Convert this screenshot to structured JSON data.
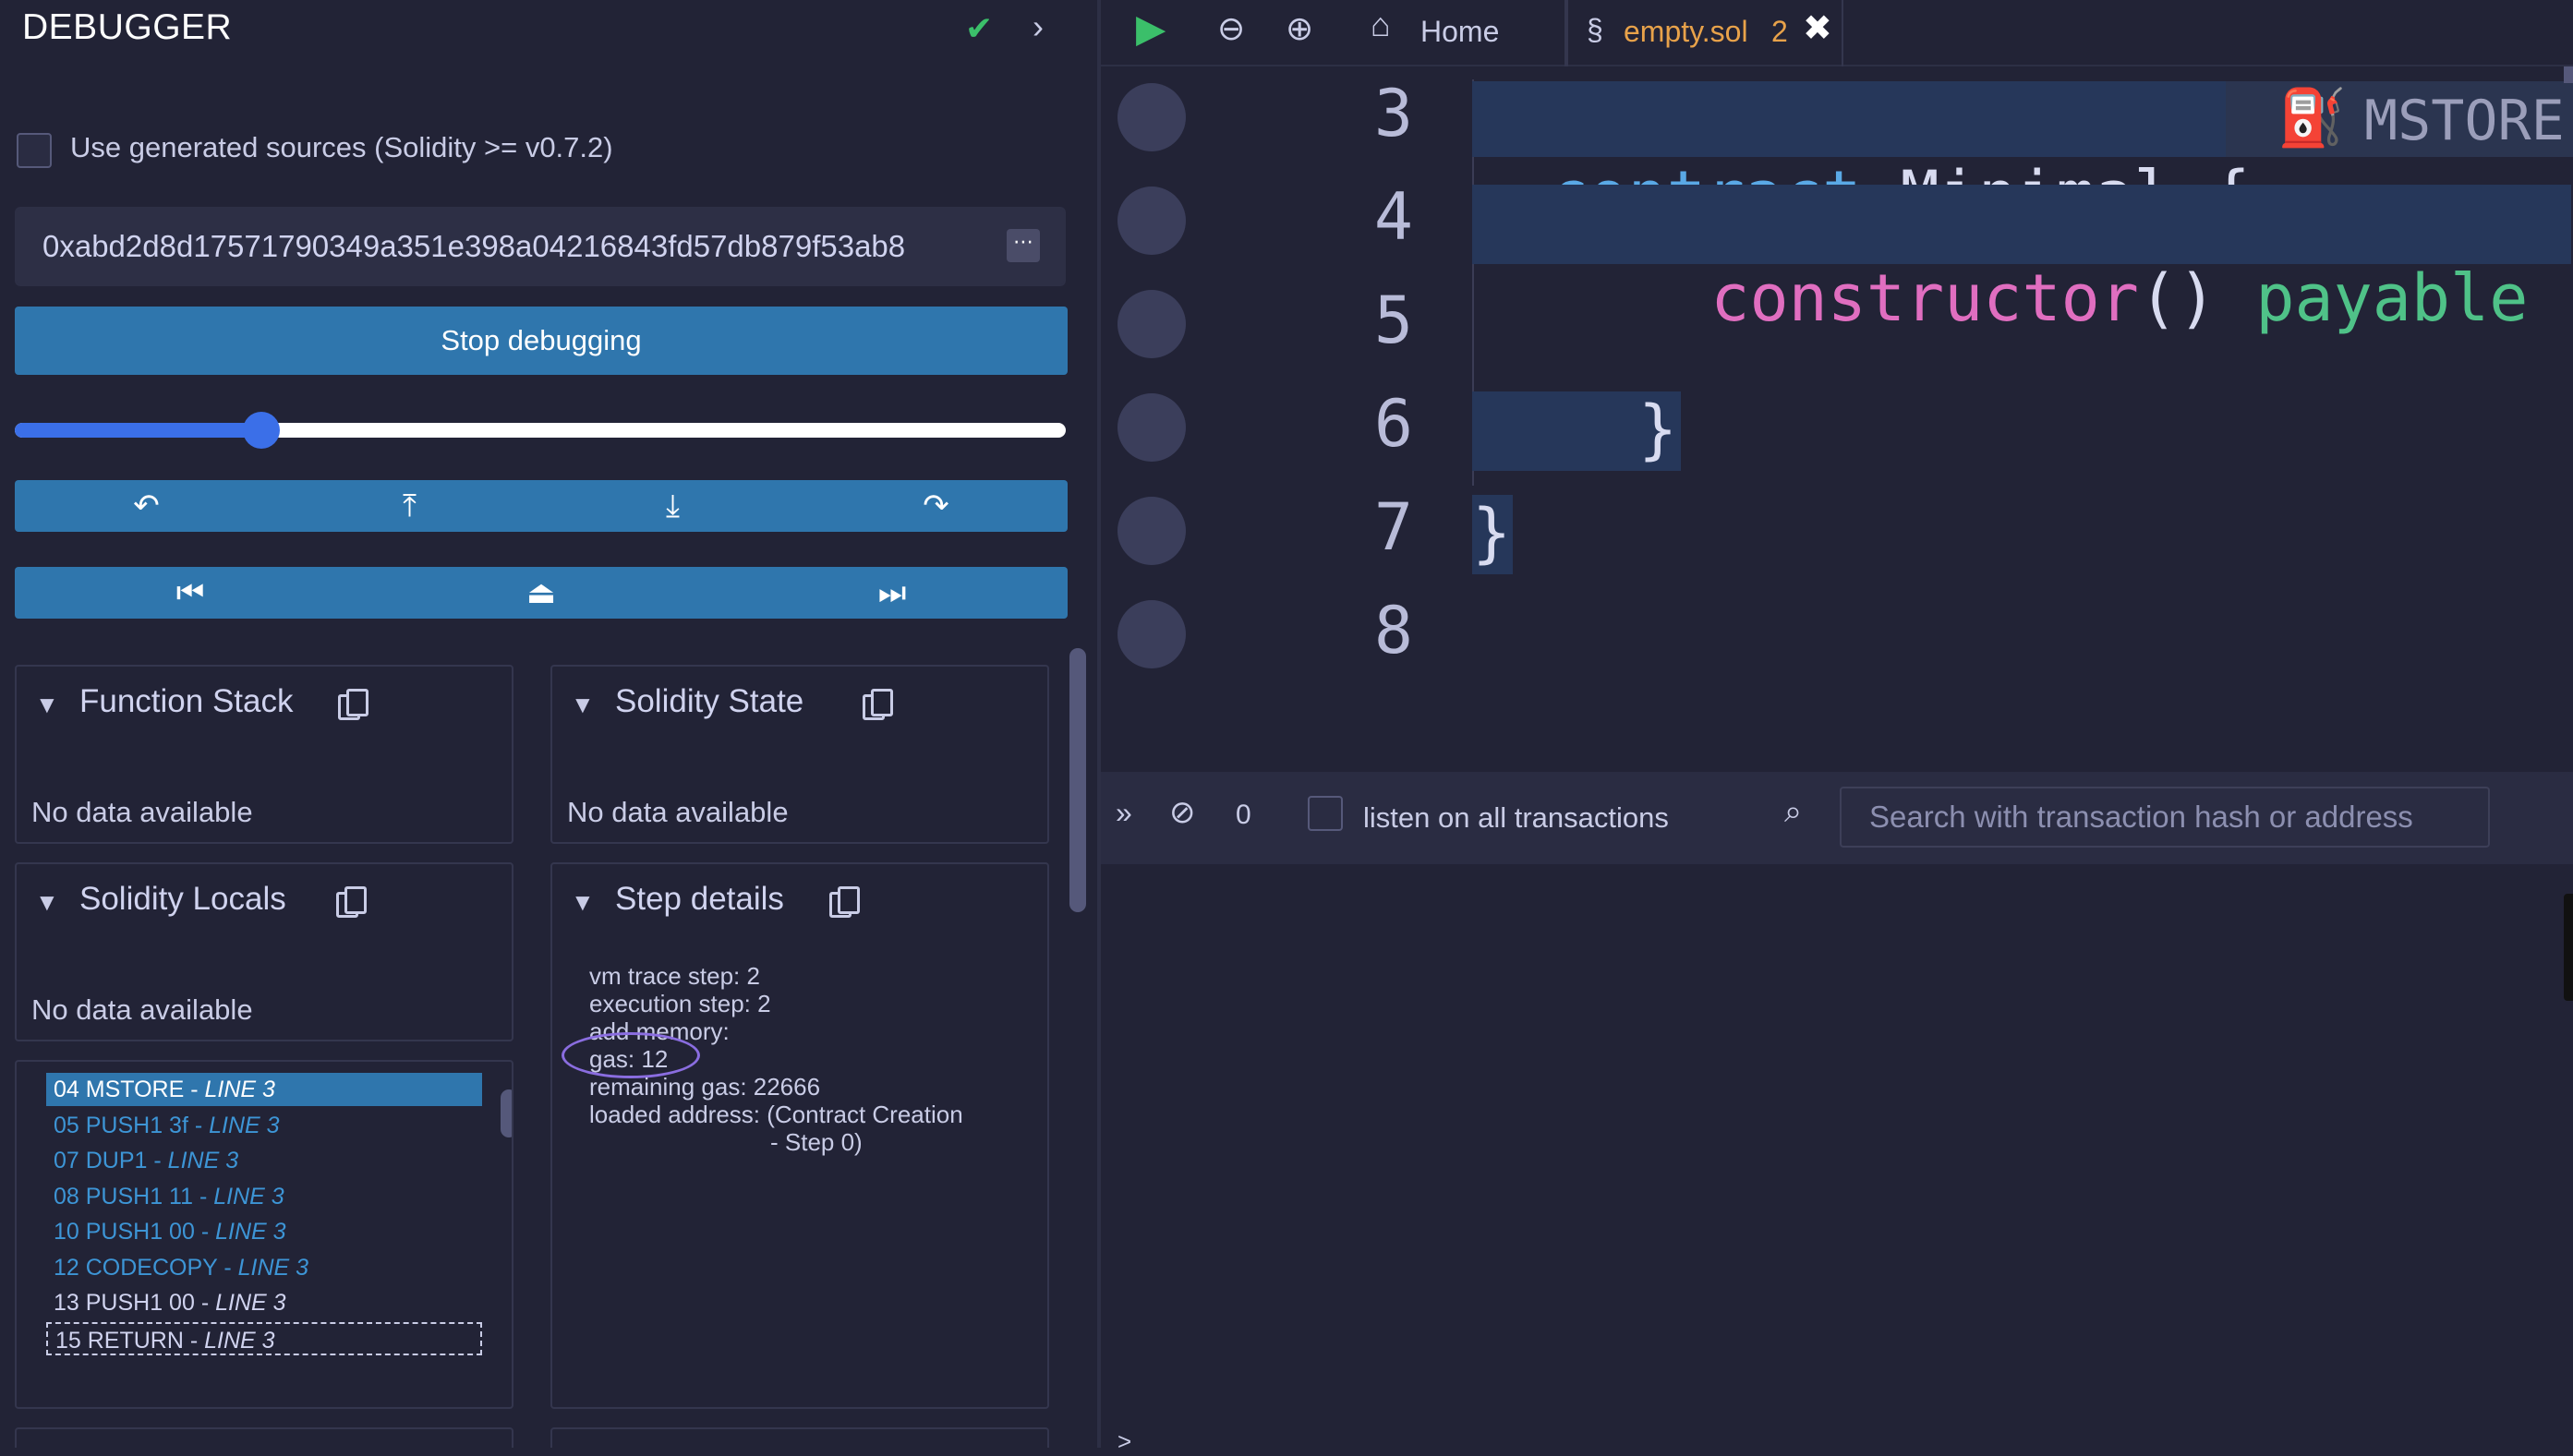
{
  "debugger": {
    "title": "DEBUGGER",
    "use_generated_label": "Use generated sources (Solidity >= v0.7.2)",
    "tx_hash": "0xabd2d8d17571790349a351e398a04216843fd57db879f53ab8",
    "stop_label": "Stop debugging",
    "slider_fraction": 0.235
  },
  "function_stack": {
    "title": "Function Stack",
    "empty": "No data available"
  },
  "solidity_state": {
    "title": "Solidity State",
    "empty": "No data available"
  },
  "solidity_locals": {
    "title": "Solidity Locals",
    "empty": "No data available"
  },
  "step_details": {
    "title": "Step details",
    "vm_trace_step": "vm trace step: 2",
    "execution_step": "execution step: 2",
    "add_memory": "add memory:",
    "gas": "gas: 12",
    "remaining_gas": "remaining gas: 22666",
    "loaded_address_1": "loaded address: (Contract Creation",
    "loaded_address_2": "- Step 0)"
  },
  "opcodes": [
    {
      "op": "04 MSTORE",
      "line": "LINE 3"
    },
    {
      "op": "05 PUSH1 3f",
      "line": "LINE 3"
    },
    {
      "op": "07 DUP1",
      "line": "LINE 3"
    },
    {
      "op": "08 PUSH1 11",
      "line": "LINE 3"
    },
    {
      "op": "10 PUSH1 00",
      "line": "LINE 3"
    },
    {
      "op": "12 CODECOPY",
      "line": "LINE 3"
    },
    {
      "op": "13 PUSH1 00",
      "line": "LINE 3"
    },
    {
      "op": "15 RETURN",
      "line": "LINE 3"
    }
  ],
  "tabs": {
    "home": "Home",
    "file": "empty.sol",
    "file_badge": "2"
  },
  "editor": {
    "line_numbers": [
      "3",
      "4",
      "5",
      "6",
      "7",
      "8"
    ],
    "l3_kw": "contract",
    "l3_name": " Minimal {",
    "l3_hint": "MSTORE",
    "l4_fn": "constructor",
    "l4_parens": "()",
    "l4_pay": "payable",
    "l6": "}",
    "l7": "}"
  },
  "terminal": {
    "count": "0",
    "listen_label": "listen on all transactions",
    "search_placeholder": "Search with transaction hash or address"
  }
}
